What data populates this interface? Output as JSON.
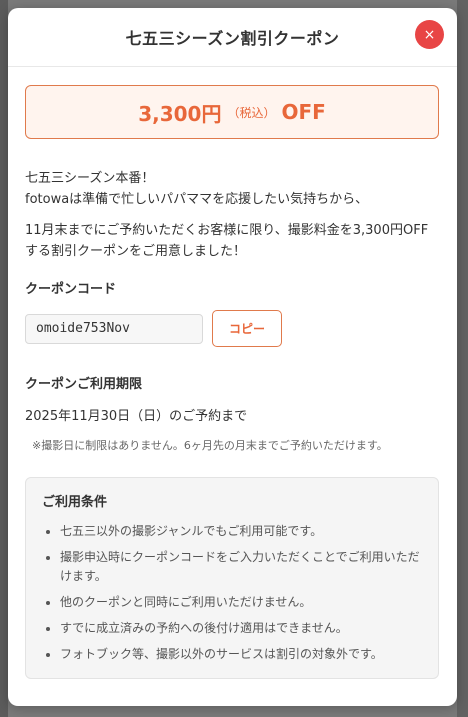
{
  "modal": {
    "title": "七五三シーズン割引クーポン",
    "close_symbol": "×"
  },
  "discount": {
    "amount": "3,300円",
    "tax_note": "（税込）",
    "off": "OFF"
  },
  "intro": {
    "line1": "七五三シーズン本番！",
    "line2": "fotowaは準備で忙しいパパママを応援したい気持ちから、",
    "paragraph2": "11月末までにご予約いただくお客様に限り、撮影料金を3,300円OFFする割引クーポンをご用意しました！"
  },
  "coupon_code": {
    "label": "クーポンコード",
    "value": "omoide753Nov",
    "copy_label": "コピー"
  },
  "validity": {
    "label": "クーポンご利用期限",
    "deadline": "2025年11月30日（日）のご予約まで",
    "note": "※撮影日に制限はありません。6ヶ月先の月末までご予約いただけます。"
  },
  "conditions": {
    "title": "ご利用条件",
    "items": [
      "七五三以外の撮影ジャンルでもご利用可能です。",
      "撮影申込時にクーポンコードをご入力いただくことでご利用いただけます。",
      "他のクーポンと同時にご利用いただけません。",
      "すでに成立済みの予約への後付け適用はできません。",
      "フォトブック等、撮影以外のサービスは割引の対象外です。"
    ]
  },
  "colors": {
    "accent": "#e8673a",
    "close_button": "#e84545"
  }
}
